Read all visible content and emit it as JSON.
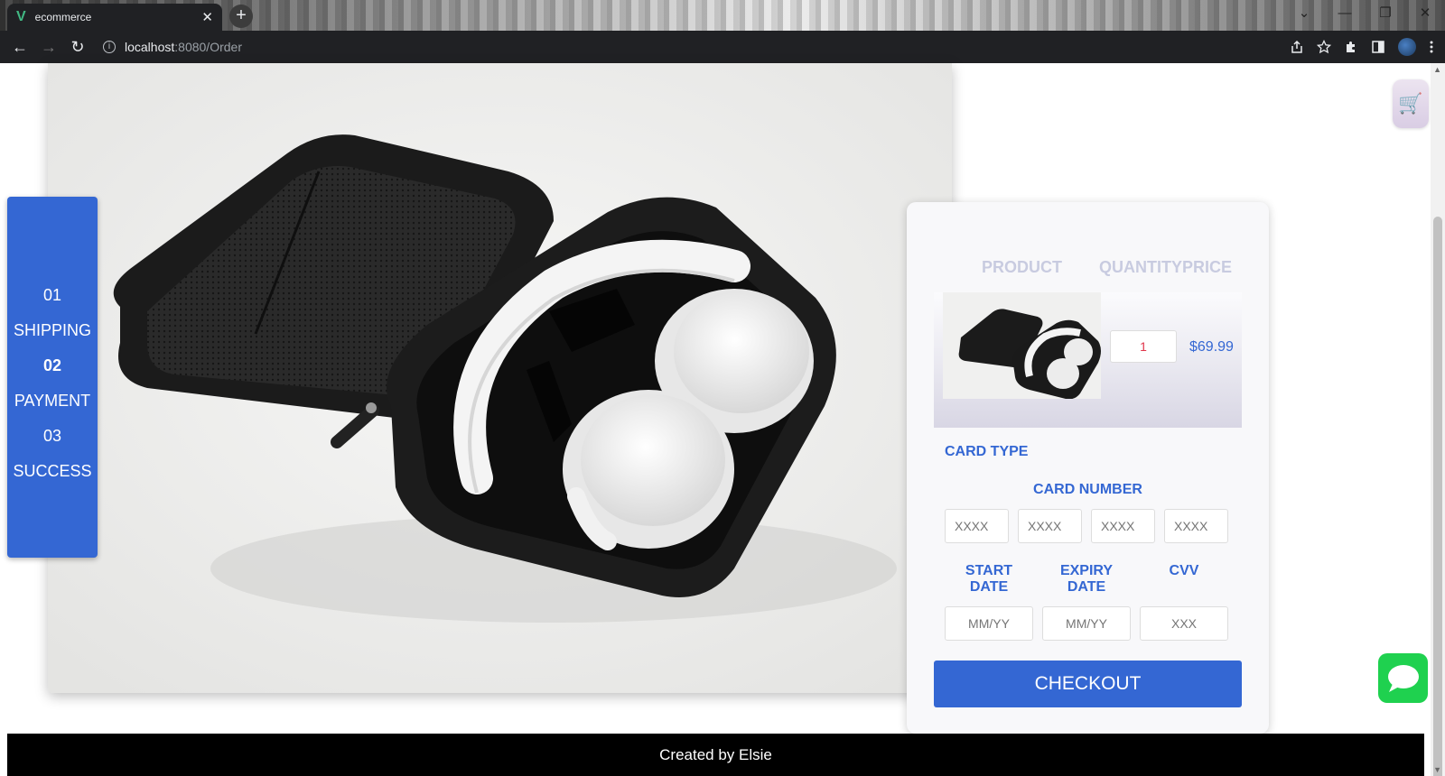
{
  "browser": {
    "tab_title": "ecommerce",
    "tab_close": "✕",
    "new_tab": "+",
    "url_host": "localhost",
    "url_path": ":8080/Order",
    "info": "i",
    "back": "←",
    "forward": "→",
    "reload": "↻",
    "controls": {
      "dropdown": "⌄",
      "minimize": "—",
      "restore": "❐",
      "close": "✕"
    }
  },
  "steps": [
    {
      "label": "01",
      "bold": false
    },
    {
      "label": "SHIPPING",
      "bold": false
    },
    {
      "label": "02",
      "bold": true
    },
    {
      "label": "PAYMENT",
      "bold": false
    },
    {
      "label": "03",
      "bold": false
    },
    {
      "label": "SUCCESS",
      "bold": false
    }
  ],
  "order": {
    "headers": {
      "product": "PRODUCT",
      "quantity_price": "QUANTITYPRICE"
    },
    "item": {
      "quantity": "1",
      "price": "$69.99"
    },
    "card_type_label": "CARD TYPE",
    "card_number_label": "CARD NUMBER",
    "card_number_placeholders": [
      "XXXX",
      "XXXX",
      "XXXX",
      "XXXX"
    ],
    "start_date_label": "START DATE",
    "expiry_date_label": "EXPIRY DATE",
    "cvv_label": "CVV",
    "start_date_placeholder": "MM/YY",
    "expiry_date_placeholder": "MM/YY",
    "cvv_placeholder": "XXX",
    "checkout_label": "CHECKOUT"
  },
  "footer": {
    "text": "Created by Elsie"
  },
  "colors": {
    "accent": "#3467d3",
    "quantity_text": "#e0364b",
    "message_green": "#1fd14f"
  }
}
